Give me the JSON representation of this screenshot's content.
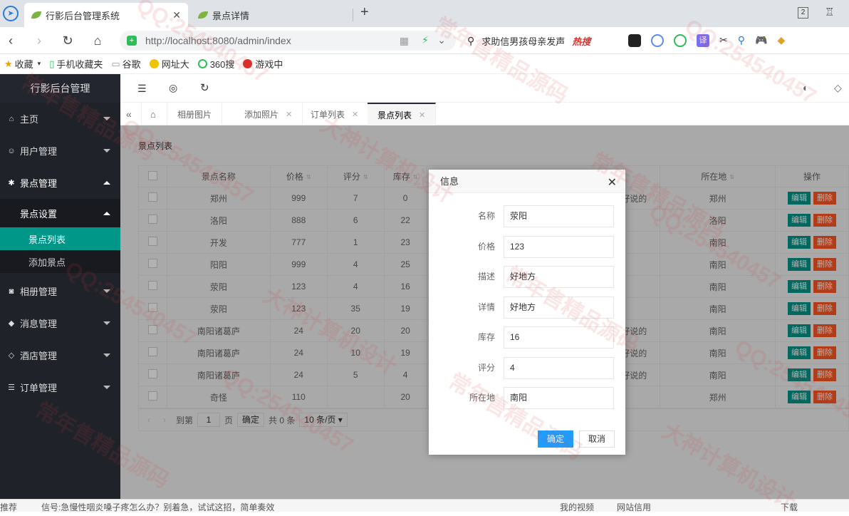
{
  "browser": {
    "tabs": [
      {
        "title": "行影后台管理系统"
      },
      {
        "title": "景点详情"
      }
    ],
    "new_tab": "+",
    "url": "http://localhost:8080/admin/index",
    "search_text": "求助信男孩母亲发声",
    "hot_label": "热搜",
    "bookmarks": [
      "收藏",
      "手机收藏夹",
      "谷歌",
      "网址大",
      "360搜",
      "游戏中"
    ],
    "tab_count": "2"
  },
  "sidebar": {
    "brand": "行影后台管理",
    "menus": [
      {
        "label": "主页",
        "icon": "⌂"
      },
      {
        "label": "用户管理",
        "icon": "☺"
      },
      {
        "label": "景点管理",
        "icon": "✱"
      },
      {
        "label": "相册管理",
        "icon": "◙"
      },
      {
        "label": "消息管理",
        "icon": "◆"
      },
      {
        "label": "酒店管理",
        "icon": "◇"
      },
      {
        "label": "订单管理",
        "icon": "☰"
      }
    ],
    "submenu_title": "景点设置",
    "subitems": [
      "景点列表",
      "添加景点"
    ]
  },
  "pagetabs": [
    "相册图片",
    "添加照片",
    "订单列表",
    "景点列表"
  ],
  "card_title": "景点列表",
  "table": {
    "headers": [
      "景点名称",
      "价格",
      "评分",
      "库存",
      "所在地",
      "操作"
    ],
    "rows": [
      {
        "name": "郑州",
        "price": "999",
        "score": "7",
        "stock": "0",
        "desc": "好说的",
        "loc": "郑州"
      },
      {
        "name": "洛阳",
        "price": "888",
        "score": "6",
        "stock": "22",
        "desc": "",
        "loc": "洛阳"
      },
      {
        "name": "开发",
        "price": "777",
        "score": "1",
        "stock": "23",
        "desc": "",
        "loc": "南阳"
      },
      {
        "name": "阳阳",
        "price": "999",
        "score": "4",
        "stock": "25",
        "desc": "",
        "loc": "南阳"
      },
      {
        "name": "荥阳",
        "price": "123",
        "score": "4",
        "stock": "16",
        "desc": "",
        "loc": "南阳"
      },
      {
        "name": "荥阳",
        "price": "123",
        "score": "35",
        "stock": "19",
        "desc": "",
        "loc": "南阳"
      },
      {
        "name": "南阳诸葛庐",
        "price": "24",
        "score": "20",
        "stock": "20",
        "desc": "好说的",
        "loc": "南阳"
      },
      {
        "name": "南阳诸葛庐",
        "price": "24",
        "score": "10",
        "stock": "19",
        "desc": "好说的",
        "loc": "南阳"
      },
      {
        "name": "南阳诸葛庐",
        "price": "24",
        "score": "5",
        "stock": "4",
        "desc": "好说的",
        "loc": "南阳"
      },
      {
        "name": "奇怪",
        "price": "110",
        "score": "",
        "stock": "20",
        "desc": "",
        "loc": "郑州"
      }
    ],
    "edit_label": "编辑",
    "delete_label": "删除"
  },
  "pager": {
    "goto": "到第",
    "page": "1",
    "page_unit": "页",
    "confirm": "确定",
    "total": "共 0 条",
    "per_page": "10 条/页"
  },
  "dialog": {
    "title": "信息",
    "fields": [
      {
        "label": "名称",
        "value": "荥阳"
      },
      {
        "label": "价格",
        "value": "123"
      },
      {
        "label": "描述",
        "value": "好地方"
      },
      {
        "label": "详情",
        "value": "好地方"
      },
      {
        "label": "库存",
        "value": "16"
      },
      {
        "label": "评分",
        "value": "4"
      },
      {
        "label": "所在地",
        "value": "南阳"
      }
    ],
    "ok": "确定",
    "cancel": "取消"
  },
  "statusbar": {
    "left": "推荐",
    "news": "信号:急慢性咽炎嗓子疼怎么办？别着急，试试这招，简单奏效",
    "video": "我的视频",
    "trust": "网站信用",
    "download": "下载"
  },
  "watermarks": [
    "QQ:254540457",
    "常年售精品源码",
    "大神计算机设计"
  ]
}
